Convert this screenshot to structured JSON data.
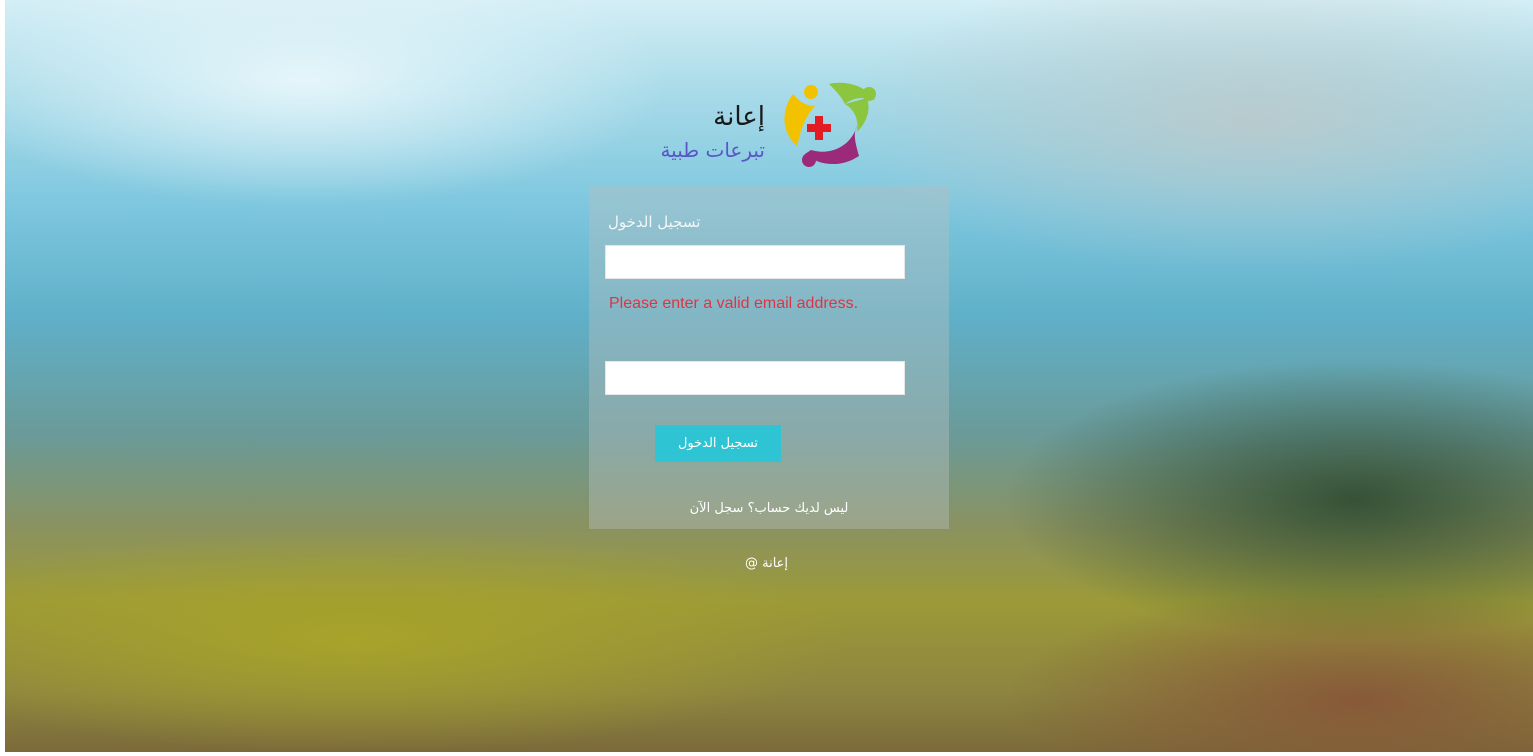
{
  "brand": {
    "name": "إعانة",
    "tagline": "تبرعات طبية"
  },
  "login": {
    "title": "تسجيل الدخول",
    "email_value": "",
    "password_value": "",
    "error_message": "Please enter a valid email address.",
    "submit_label": "تسجيل الدخول",
    "register_prompt": "ليس لديك حساب؟ سجل الآن"
  },
  "footer": {
    "text": "إعانة @"
  },
  "colors": {
    "accent": "#2ec4d3",
    "error": "#dc3545",
    "logo_yellow": "#f2c200",
    "logo_green": "#8cc63f",
    "logo_purple": "#9b2a7a",
    "logo_red_cross": "#e31b23",
    "tagline_purple": "#5a56c6"
  },
  "icons": {
    "logo_mark": "people-circle-red-cross-icon"
  }
}
